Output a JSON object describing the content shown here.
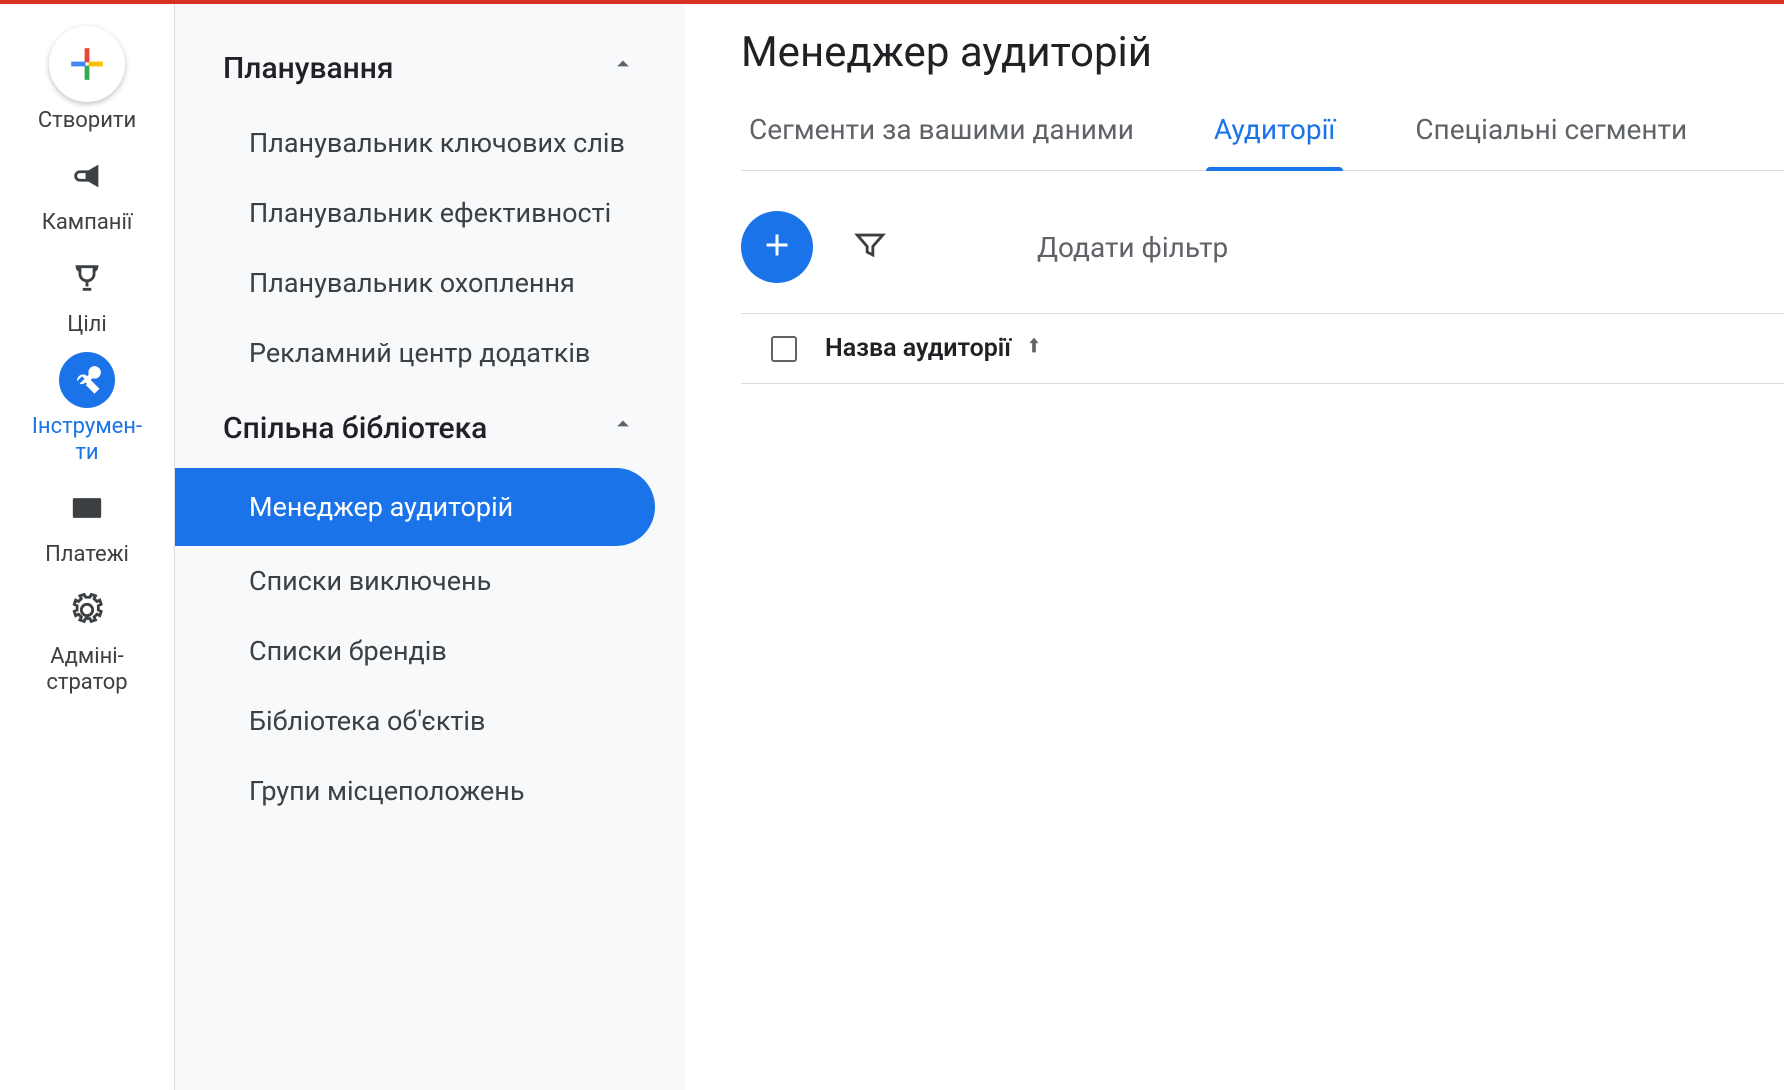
{
  "rail": {
    "create": "Створити",
    "campaigns": "Кампанії",
    "goals": "Цілі",
    "tools": "Інструмен-\nти",
    "payments": "Платежі",
    "admin": "Адміні-\nстратор"
  },
  "sidebar": {
    "groups": [
      {
        "title": "Планування",
        "items": [
          "Планувальник ключових слів",
          "Планувальник ефективності",
          "Планувальник охоплення",
          "Рекламний центр додатків"
        ]
      },
      {
        "title": "Спільна бібліотека",
        "items": [
          "Менеджер аудиторій",
          "Списки виключень",
          "Списки брендів",
          "Бібліотека об'єктів",
          "Групи місцеположень"
        ]
      }
    ]
  },
  "main": {
    "title": "Менеджер аудиторій",
    "tabs": [
      "Сегменти за вашими даними",
      "Аудиторії",
      "Спеціальні сегменти"
    ],
    "filter_placeholder": "Додати фільтр",
    "column_name": "Назва аудиторії"
  }
}
